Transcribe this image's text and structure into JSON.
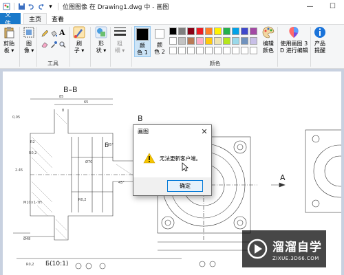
{
  "window": {
    "title": "位图图像 在 Drawing1.dwg 中 - 画图",
    "minimize": "—",
    "maximize": "☐"
  },
  "tabs": {
    "file": "文件",
    "home": "主页",
    "view": "查看"
  },
  "ribbon": {
    "clipboard": {
      "label_line1": "剪贴",
      "label_line2": "板 ▾"
    },
    "image": {
      "label_line1": "图",
      "label_line2": "像 ▾"
    },
    "tools": {
      "group_label": "工具"
    },
    "brushes": {
      "label_line1": "刷",
      "label_line2": "子 ▾"
    },
    "shapes": {
      "label_line1": "形",
      "label_line2": "状 ▾"
    },
    "outline": {
      "label_line1": "粗",
      "label_line2": "细 ▾"
    },
    "size": {
      "label": "粗细"
    },
    "color1": {
      "label_line1": "颜",
      "label_line2": "色 1"
    },
    "color2": {
      "label_line1": "颜",
      "label_line2": "色 2"
    },
    "edit_colors": {
      "label_line1": "编辑",
      "label_line2": "颜色"
    },
    "colors_group": {
      "group_label": "颜色"
    },
    "paint3d": {
      "label_line1": "使用画图 3",
      "label_line2": "D 进行编辑"
    },
    "product_alert": {
      "label_line1": "产品",
      "label_line2": "提醒"
    },
    "palette": [
      "#000000",
      "#7f7f7f",
      "#880015",
      "#ed1c24",
      "#ff7f27",
      "#fff200",
      "#22b14c",
      "#00a2e8",
      "#3f48cc",
      "#a349a4",
      "#ffffff",
      "#c3c3c3",
      "#b97a57",
      "#ffaec9",
      "#ffc90e",
      "#efe4b0",
      "#b5e61d",
      "#99d9ea",
      "#7092be",
      "#c8bfe7"
    ]
  },
  "drawing": {
    "section_label": "B–B",
    "view_label_b": "B",
    "view_label_a": "A",
    "view_label_b2": "Б",
    "bottom_label": "Б(10:1)",
    "dims": [
      "85",
      "65",
      "8",
      "45°",
      "0,05",
      "R2",
      "R0,2",
      "45°",
      "Ø70",
      "R0,2",
      "Ø48",
      "M10×1-7H",
      "R0,2",
      "2.45"
    ]
  },
  "dialog": {
    "title": "画图",
    "message": "无法更新客户端。",
    "ok": "确定",
    "close": "✕"
  },
  "watermark": {
    "cn": "溜溜自学",
    "url": "ZIXUE.3D66.COM"
  }
}
